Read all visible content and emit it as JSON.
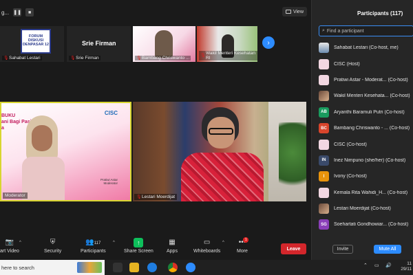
{
  "topbar": {
    "recording_label": "g...",
    "pause_icon": "pause-icon",
    "stop_icon": "stop-icon",
    "view_label": "View"
  },
  "thumbnails": [
    {
      "name": "Sahabat Lestari",
      "logo_text": "FORUM DISKUSI DENPASAR 12",
      "muted": true
    },
    {
      "name": "Srie Firman",
      "display_text": "Srie Firman",
      "muted": true
    },
    {
      "name": "Bambang Chriswanto ...",
      "muted": true
    },
    {
      "name": "Wakil Menteri Kesehatan RI",
      "muted": true
    }
  ],
  "tiles": [
    {
      "name": "Moderator",
      "slide_lines": [
        "BUKU",
        "ani Bagi Pasien",
        "a"
      ],
      "logo": "CISC",
      "caption_lines": [
        "Pratiwi Astar",
        "Moderator"
      ],
      "active_speaker": true
    },
    {
      "name": "Lestari Moerdijat",
      "muted": true
    }
  ],
  "toolbar": {
    "items": [
      {
        "label": "art Video",
        "icon": "video-off-icon"
      },
      {
        "label": "Security",
        "icon": "shield-icon"
      },
      {
        "label": "Participants",
        "icon": "participants-icon",
        "count": "117"
      },
      {
        "label": "Share Screen",
        "icon": "share-screen-icon"
      },
      {
        "label": "Apps",
        "icon": "apps-icon"
      },
      {
        "label": "Whiteboards",
        "icon": "whiteboard-icon"
      },
      {
        "label": "More",
        "icon": "more-icon",
        "badge": "1"
      }
    ],
    "leave_label": "Leave"
  },
  "taskbar": {
    "search_placeholder": "here to search",
    "clock_time": "11",
    "clock_date": "29/11"
  },
  "participants_panel": {
    "title": "Participants (117)",
    "find_placeholder": "Find a participant",
    "participants": [
      {
        "name": "Sahabat Lestari (Co-host, me)",
        "avatar": "",
        "color": ""
      },
      {
        "name": "CISC (Host)",
        "avatar": "",
        "color": ""
      },
      {
        "name": "Pratiwi Astar - Moderat... (Co-host)",
        "avatar": "",
        "color": ""
      },
      {
        "name": "Wakil Menteri Kesehata... (Co-host)",
        "avatar": "",
        "color": ""
      },
      {
        "name": "Aryanthi Baramuli Putri (Co-host)",
        "avatar": "AB",
        "color": "#1a9b5e"
      },
      {
        "name": "Bambang Chriswanto - ... (Co-host)",
        "avatar": "BC",
        "color": "#d9452c"
      },
      {
        "name": "CISC (Co-host)",
        "avatar": "",
        "color": ""
      },
      {
        "name": "Inez Nimpuno (she/her) (Co-host)",
        "avatar": "IN",
        "color": "#3a4a6a"
      },
      {
        "name": "Ivony (Co-host)",
        "avatar": "I",
        "color": "#e8930c"
      },
      {
        "name": "Kemala Rita Wahidi_H... (Co-host)",
        "avatar": "",
        "color": ""
      },
      {
        "name": "Lestari Moerdijat (Co-host)",
        "avatar": "",
        "color": ""
      },
      {
        "name": "Soehartati Gondhowiar... (Co-host)",
        "avatar": "SG",
        "color": "#8a3fb8"
      }
    ],
    "invite_label": "Invite",
    "mute_all_label": "Mute All"
  }
}
